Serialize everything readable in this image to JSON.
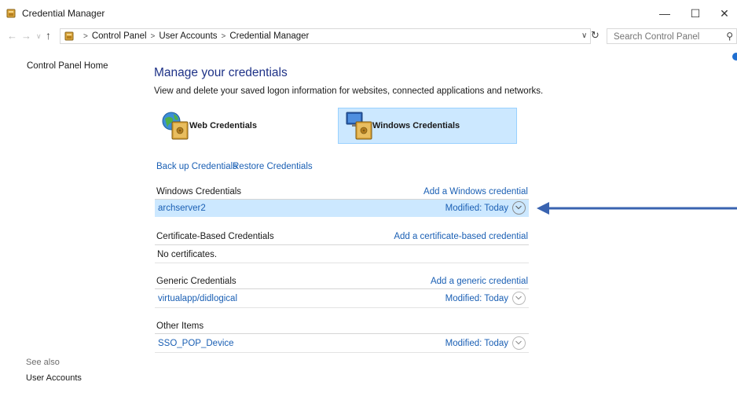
{
  "window": {
    "title": "Credential Manager",
    "controls": {
      "minimize": "—",
      "maximize": "☐",
      "close": "✕"
    }
  },
  "nav": {
    "back": "←",
    "forward": "→",
    "recent": "∨",
    "up": "↑",
    "breadcrumbs": [
      "Control Panel",
      "User Accounts",
      "Credential Manager"
    ],
    "dropdown": "∨",
    "refresh": "↻",
    "search_placeholder": "Search Control Panel",
    "search_icon": "⚲"
  },
  "leftpane": {
    "home": "Control Panel Home",
    "see_also": "See also",
    "see_also_links": [
      "User Accounts"
    ]
  },
  "main": {
    "heading": "Manage your credentials",
    "subtitle": "View and delete your saved logon information for websites, connected applications and networks.",
    "tiles": [
      {
        "label": "Web Credentials",
        "icon": "globe-vault-icon",
        "selected": false
      },
      {
        "label": "Windows Credentials",
        "icon": "computer-vault-icon",
        "selected": true
      }
    ],
    "backup_link": "Back up Credentials",
    "restore_link": "Restore Credentials",
    "sections": {
      "windows": {
        "title": "Windows Credentials",
        "action": "Add a Windows credential",
        "items": [
          {
            "name": "archserver2",
            "modified": "Modified:  Today"
          }
        ]
      },
      "certificate": {
        "title": "Certificate-Based Credentials",
        "action": "Add a certificate-based credential",
        "empty": "No certificates."
      },
      "generic": {
        "title": "Generic Credentials",
        "action": "Add a generic credential",
        "items": [
          {
            "name": "virtualapp/didlogical",
            "modified": "Modified:  Today"
          }
        ]
      },
      "other": {
        "title": "Other Items",
        "items": [
          {
            "name": "SSO_POP_Device",
            "modified": "Modified:  Today"
          }
        ]
      }
    }
  },
  "colors": {
    "link": "#1a5fb4",
    "heading": "#1e3287",
    "selection": "#cce8ff",
    "annotation_arrow": "#3a63b0"
  }
}
